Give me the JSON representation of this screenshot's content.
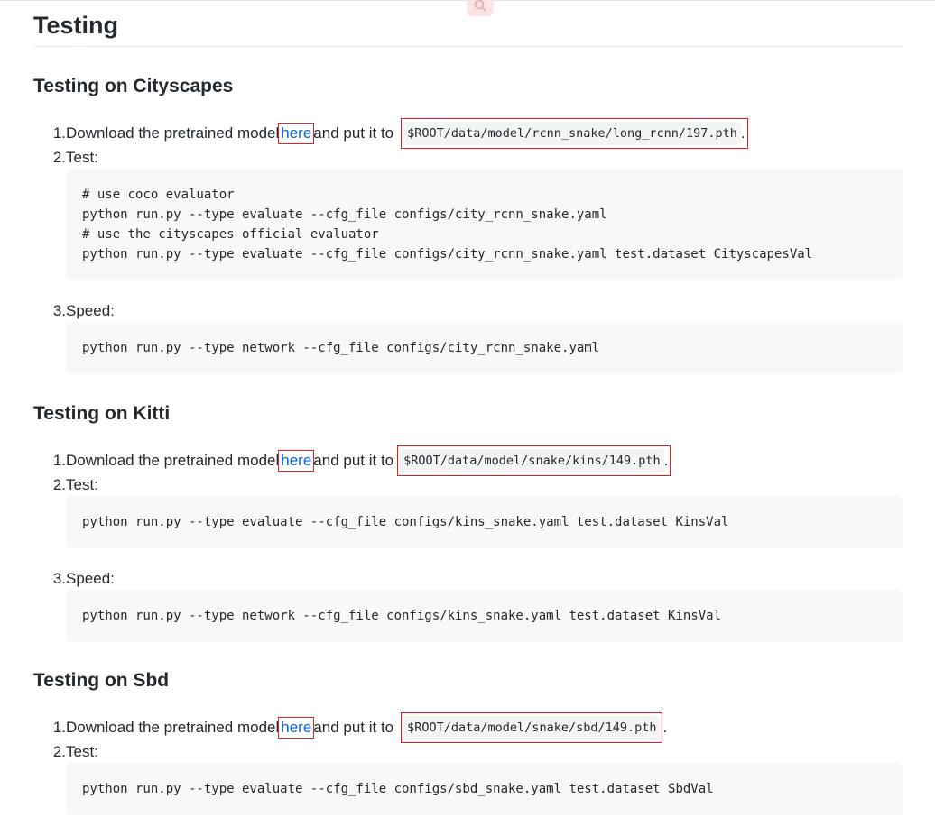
{
  "page": {
    "title": "Testing"
  },
  "sections": [
    {
      "heading": "Testing on Cityscapes",
      "steps": [
        {
          "num": "1.",
          "pre": "Download the pretrained model ",
          "link": "here",
          "mid": " and put it to ",
          "path": "$ROOT/data/model/rcnn_snake/long_rcnn/197.pth",
          "post": "."
        },
        {
          "num": "2.",
          "text": "Test:"
        },
        {
          "num": "3.",
          "text": "Speed:"
        }
      ],
      "test_code": [
        "# use coco evaluator",
        "python run.py --type evaluate --cfg_file configs/city_rcnn_snake.yaml",
        "# use the cityscapes official evaluator",
        "python run.py --type evaluate --cfg_file configs/city_rcnn_snake.yaml test.dataset CityscapesVal"
      ],
      "speed_code": [
        "python run.py --type network --cfg_file configs/city_rcnn_snake.yaml"
      ]
    },
    {
      "heading": "Testing on Kitti",
      "steps": [
        {
          "num": "1.",
          "pre": "Download the pretrained model ",
          "link": "here",
          "mid": " and put it to ",
          "path": "$ROOT/data/model/snake/kins/149.pth",
          "post": "."
        },
        {
          "num": "2.",
          "text": "Test:"
        },
        {
          "num": "3.",
          "text": "Speed:"
        }
      ],
      "test_code": [
        "python run.py --type evaluate --cfg_file configs/kins_snake.yaml test.dataset KinsVal"
      ],
      "speed_code": [
        "python run.py --type network --cfg_file configs/kins_snake.yaml test.dataset KinsVal"
      ]
    },
    {
      "heading": "Testing on Sbd",
      "steps": [
        {
          "num": "1.",
          "pre": "Download the pretrained model ",
          "link": "here",
          "mid": " and put it to ",
          "path": "$ROOT/data/model/snake/sbd/149.pth",
          "post": "."
        },
        {
          "num": "2.",
          "text": "Test:"
        }
      ],
      "test_code": [
        "python run.py --type evaluate --cfg_file configs/sbd_snake.yaml test.dataset SbdVal"
      ]
    }
  ],
  "icons": {
    "floating": "search-icon"
  },
  "colors": {
    "link": "#0366d6",
    "highlight": "#e0252a",
    "code_bg": "#f6f8fa"
  }
}
